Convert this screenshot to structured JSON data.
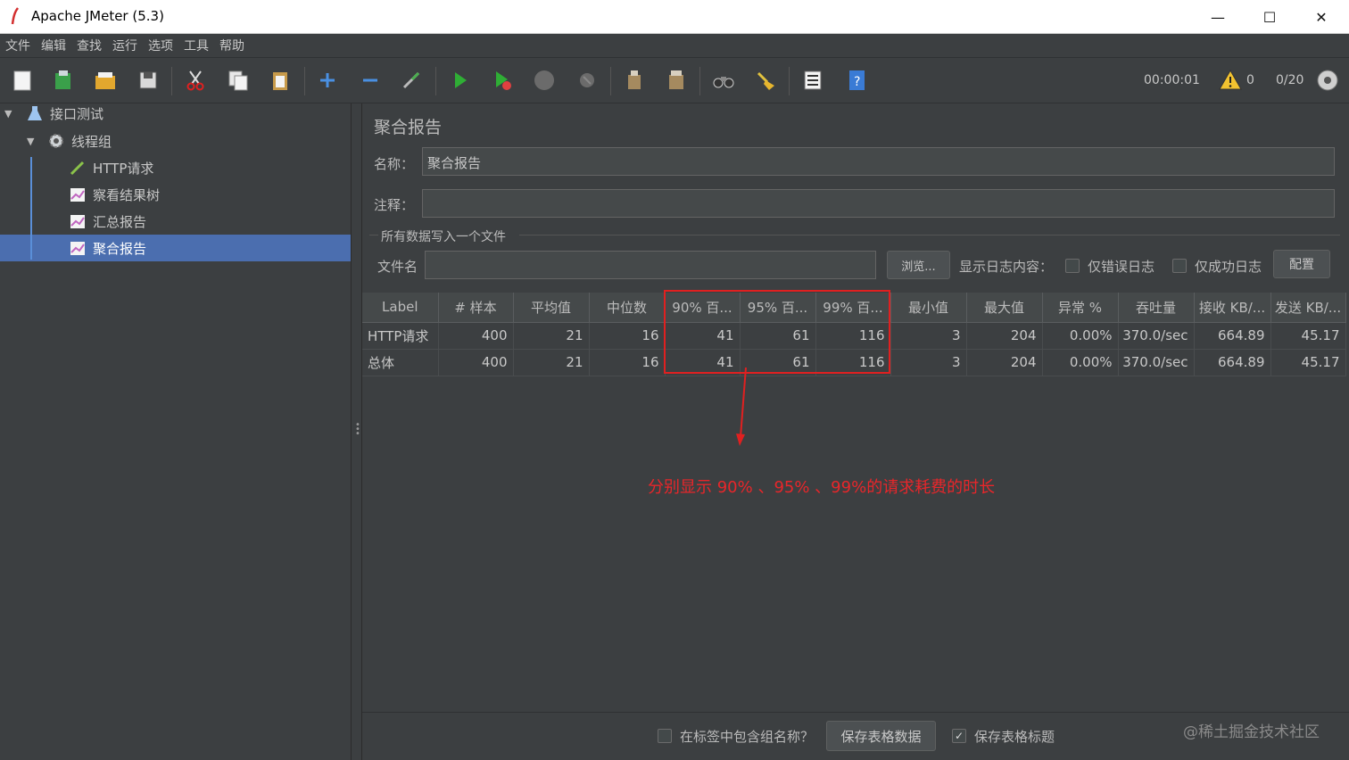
{
  "window": {
    "title": "Apache JMeter (5.3)",
    "min": "—",
    "max": "☐",
    "close": "✕"
  },
  "menu": [
    "文件",
    "编辑",
    "查找",
    "运行",
    "选项",
    "工具",
    "帮助"
  ],
  "toolbar": {
    "timer": "00:00:01",
    "warn_count": "0",
    "threads": "0/20"
  },
  "tree": {
    "items": [
      {
        "label": "接口测试",
        "icon": "test-plan-icon"
      },
      {
        "label": "线程组",
        "icon": "gear-icon"
      },
      {
        "label": "HTTP请求",
        "icon": "pipette-icon"
      },
      {
        "label": "察看结果树",
        "icon": "chart-icon"
      },
      {
        "label": "汇总报告",
        "icon": "chart-icon"
      },
      {
        "label": "聚合报告",
        "icon": "chart-icon"
      }
    ],
    "selected": "聚合报告"
  },
  "panel": {
    "title": "聚合报告",
    "name_label": "名称：",
    "name_value": "聚合报告",
    "comment_label": "注释：",
    "comment_value": "",
    "group_title": "所有数据写入一个文件",
    "file_label": "文件名",
    "file_value": "",
    "browse_label": "浏览...",
    "log_label": "显示日志内容：",
    "errors_only": "仅错误日志",
    "success_only": "仅成功日志",
    "config_label": "配置"
  },
  "table": {
    "headers": [
      "Label",
      "# 样本",
      "平均值",
      "中位数",
      "90% 百...",
      "95% 百...",
      "99% 百...",
      "最小值",
      "最大值",
      "异常 %",
      "吞吐量",
      "接收 KB/...",
      "发送 KB/..."
    ],
    "rows": [
      [
        "HTTP请求",
        "400",
        "21",
        "16",
        "41",
        "61",
        "116",
        "3",
        "204",
        "0.00%",
        "370.0/sec",
        "664.89",
        "45.17"
      ],
      [
        "总体",
        "400",
        "21",
        "16",
        "41",
        "61",
        "116",
        "3",
        "204",
        "0.00%",
        "370.0/sec",
        "664.89",
        "45.17"
      ]
    ]
  },
  "annotation": "分别显示 90% 、95% 、99%的请求耗费的时长",
  "bottom": {
    "include_group": "在标签中包含组名称？",
    "save_data": "保存表格数据",
    "save_header": "保存表格标题",
    "save_header_checked": true
  },
  "watermark": "@稀土掘金技术社区",
  "colors": {
    "background": "#3c3f41",
    "selection": "#4b6eaf",
    "annotation": "#e8262a"
  }
}
